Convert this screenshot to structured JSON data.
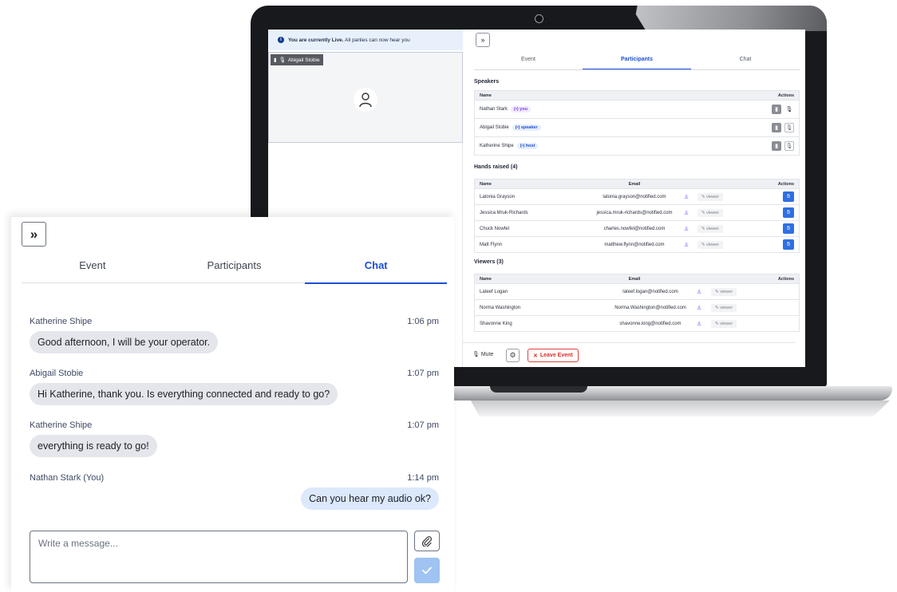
{
  "laptop": {
    "live_banner": {
      "bold": "You are currently Live.",
      "rest": " All parties can now hear you"
    },
    "video_tile_label": "Abigail Stobie",
    "panel": {
      "expand_glyph": "»",
      "tabs": [
        {
          "label": "Event",
          "active": false
        },
        {
          "label": "Participants",
          "active": true
        },
        {
          "label": "Chat",
          "active": false
        }
      ],
      "speakers": {
        "title": "Speakers",
        "columns": {
          "name": "Name",
          "actions": "Actions"
        },
        "rows": [
          {
            "name": "Nathan Stark",
            "tag": "(•) you"
          },
          {
            "name": "Abigail Stobie",
            "tag": "(•) speaker"
          },
          {
            "name": "Katherine Shipe",
            "tag": "(•) host"
          }
        ]
      },
      "hands_raised": {
        "title": "Hands raised (4)",
        "columns": {
          "name": "Name",
          "email": "Email",
          "actions": "Actions"
        },
        "rows": [
          {
            "name": "Latonia Grayson",
            "email": "latonia.grayson@notified.com",
            "role": "viewer"
          },
          {
            "name": "Jessica Mruk-Richards",
            "email": "jessica.mruk-richards@notified.com",
            "role": "viewer"
          },
          {
            "name": "Chuck Nowfel",
            "email": "charles.nowfel@notified.com",
            "role": "viewer"
          },
          {
            "name": "Matt Flynn",
            "email": "matthew.flynn@notified.com",
            "role": "viewer"
          }
        ]
      },
      "viewers": {
        "title": "Viewers (3)",
        "columns": {
          "name": "Name",
          "email": "Email",
          "actions": "Actions"
        },
        "rows": [
          {
            "name": "Lateef Logan",
            "email": "lateef.logan@notified.com",
            "role": "viewer"
          },
          {
            "name": "Norma Washington",
            "email": "Norma.Washington@notified.com",
            "role": "viewer"
          },
          {
            "name": "Shavonne King",
            "email": "shavonne.king@notified.com",
            "role": "viewer"
          }
        ]
      },
      "footer": {
        "mute_label": "Mute",
        "leave_label": "Leave Event"
      }
    }
  },
  "chat_card": {
    "expand_glyph": "»",
    "tabs": [
      {
        "label": "Event",
        "active": false
      },
      {
        "label": "Participants",
        "active": false
      },
      {
        "label": "Chat",
        "active": true
      }
    ],
    "messages": [
      {
        "author": "Katherine Shipe",
        "time": "1:06 pm",
        "text": "Good afternoon, I will be your operator.",
        "mine": false
      },
      {
        "author": "Abigail Stobie",
        "time": "1:07 pm",
        "text": "Hi Katherine, thank you. Is everything connected and ready to go?",
        "mine": false
      },
      {
        "author": "Katherine Shipe",
        "time": "1:07 pm",
        "text": "everything is ready to go!",
        "mine": false
      },
      {
        "author": "Nathan Stark (You)",
        "time": "1:14 pm",
        "text": "Can you hear my audio ok?",
        "mine": true
      }
    ],
    "compose": {
      "placeholder": "Write a message..."
    },
    "icons": {
      "attach": "paperclip-icon",
      "send": "check-icon",
      "expand": "double-chevron-right-icon"
    },
    "colors": {
      "accent": "#1d4ed8",
      "send_button": "#9fc3f2",
      "bubble": "#e4e6ec",
      "bubble_mine": "#dce8fb"
    }
  }
}
